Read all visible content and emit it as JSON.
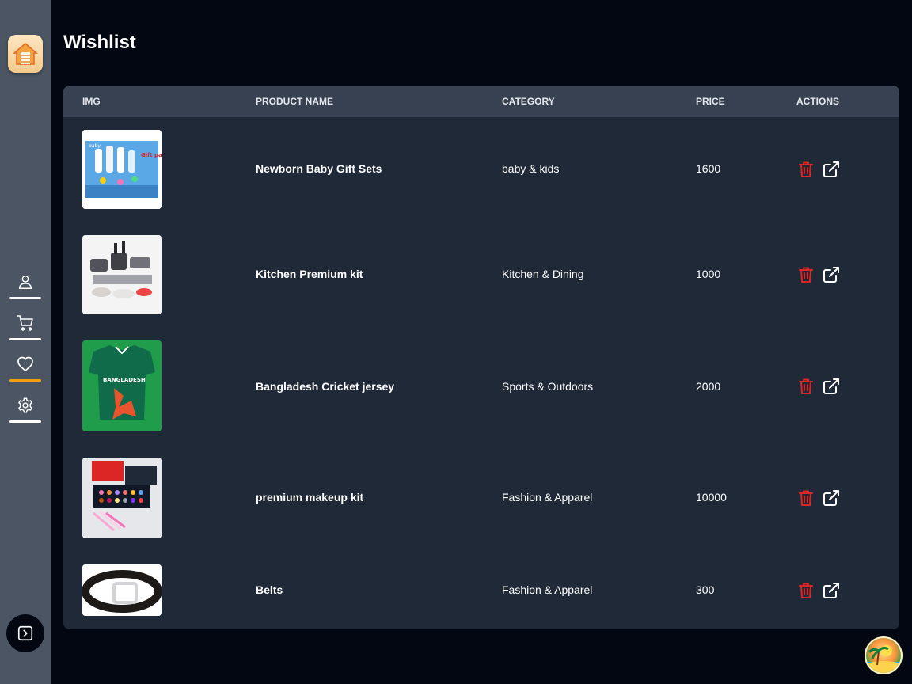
{
  "page": {
    "title": "Wishlist"
  },
  "sidebar": {
    "logo_icon": "home-house-icon",
    "items": [
      {
        "name": "profile",
        "icon": "user-icon",
        "active": false
      },
      {
        "name": "cart",
        "icon": "cart-icon",
        "active": false
      },
      {
        "name": "wishlist",
        "icon": "heart-icon",
        "active": true
      },
      {
        "name": "settings",
        "icon": "gear-icon",
        "active": false
      }
    ],
    "expand_icon": "chevron-right-square-icon"
  },
  "table": {
    "headers": {
      "img": "img",
      "name": "Product Name",
      "category": "Category",
      "price": "Price",
      "actions": "Actions"
    },
    "rows": [
      {
        "name": "Newborn Baby Gift Sets",
        "category": "baby & kids",
        "price": "1600",
        "image": "baby-gift-set-box"
      },
      {
        "name": "Kitchen Premium kit",
        "category": "Kitchen & Dining",
        "price": "1000",
        "image": "kitchen-cookware-set"
      },
      {
        "name": "Bangladesh Cricket jersey",
        "category": "Sports & Outdoors",
        "price": "2000",
        "image": "green-cricket-jersey"
      },
      {
        "name": "premium makeup kit",
        "category": "Fashion & Apparel",
        "price": "10000",
        "image": "makeup-kit-case"
      },
      {
        "name": "Belts",
        "category": "Fashion & Apparel",
        "price": "300",
        "image": "leather-belt"
      }
    ]
  },
  "thumb_labels": {
    "baby_brand": "baby",
    "gift_pack": "Gift pack",
    "jersey_text": "BANGLADESH"
  },
  "colors": {
    "sidebar_bg": "#4b5563",
    "page_bg": "#030712",
    "card_bg": "#1f2937",
    "header_bg": "#374151",
    "delete": "#dc2626",
    "active_underline": "#f59e0b"
  }
}
